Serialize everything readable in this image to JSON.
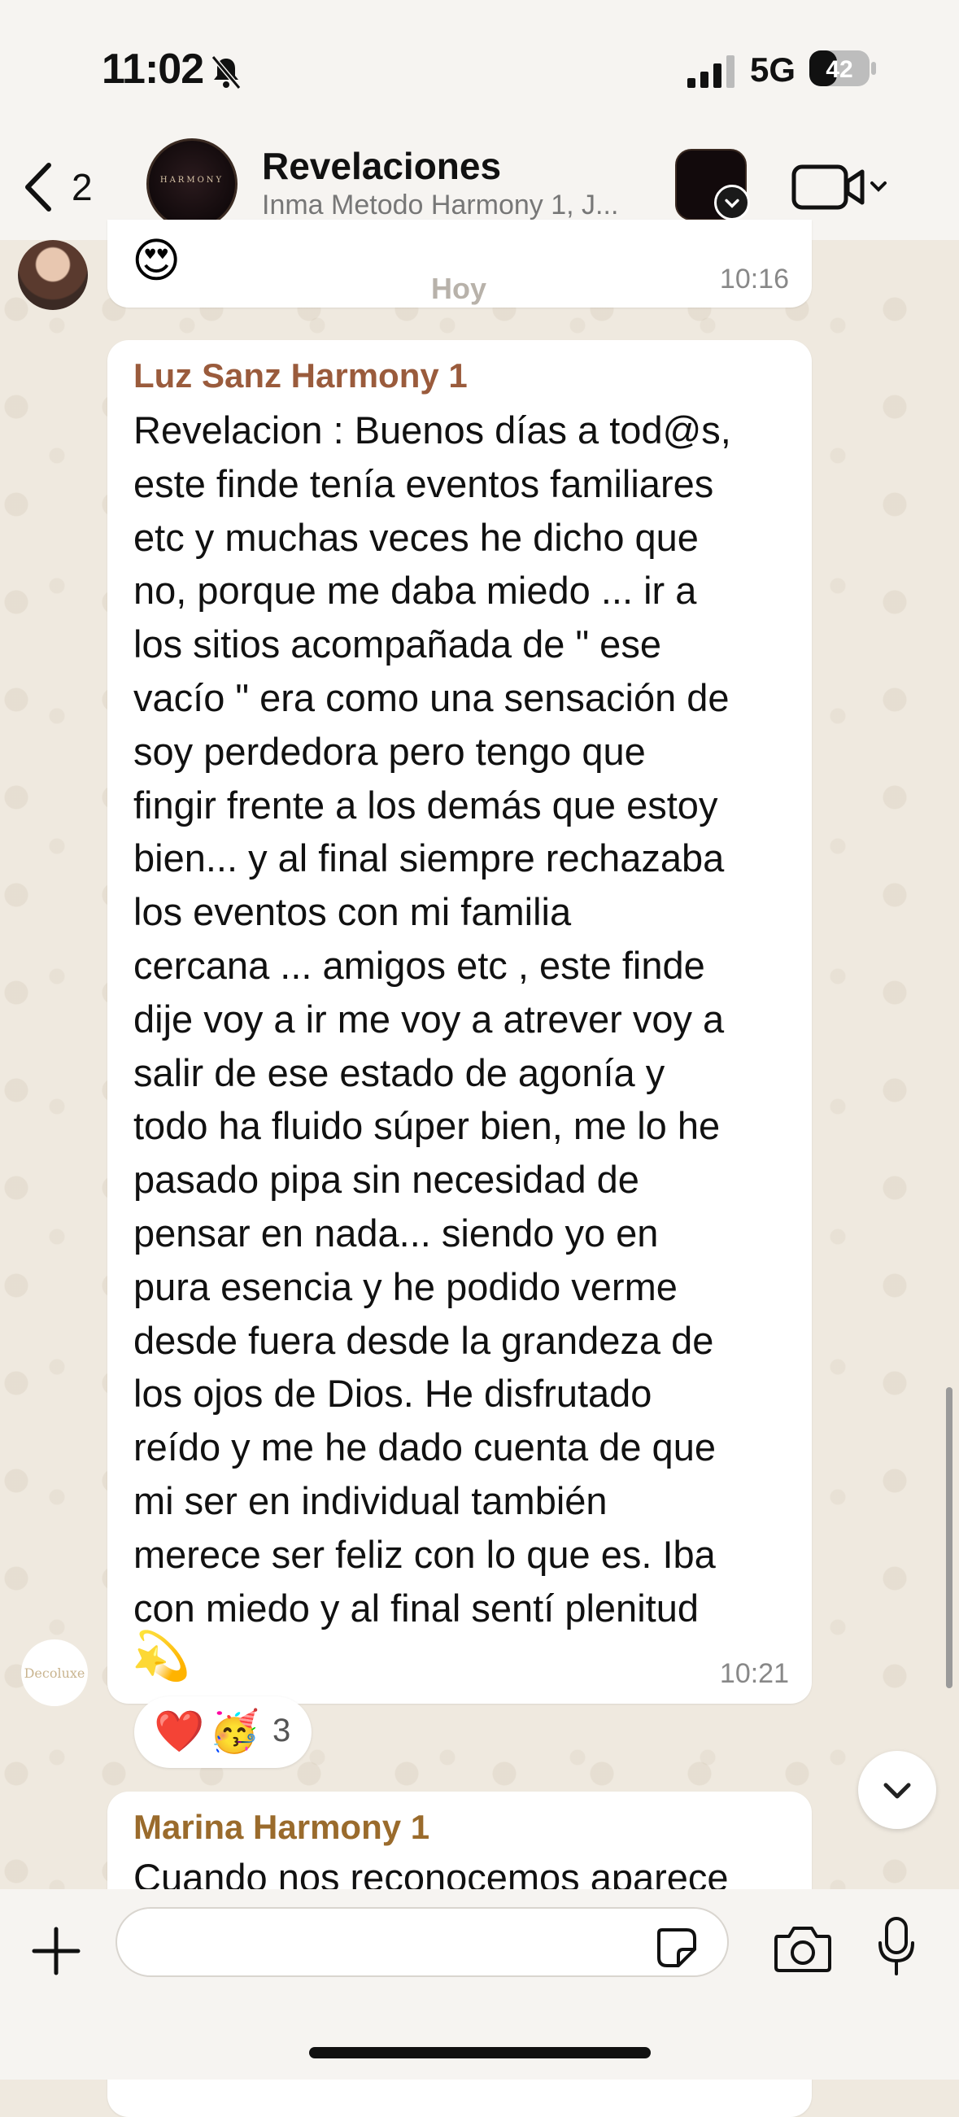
{
  "status_bar": {
    "time": "11:02",
    "network": "5G",
    "battery": "42"
  },
  "header": {
    "back_count": "2",
    "group_avatar_text": "HARMONY",
    "title": "Revelaciones",
    "subtitle": "Inma Metodo Harmony 1, J..."
  },
  "messages": {
    "top_emoji": "😍",
    "top_time": "10:16",
    "day_label": "Hoy",
    "main": {
      "sender": "Luz Sanz Harmony 1",
      "text": "Revelacion : Buenos días a tod@s,\neste finde tenía eventos familiares\netc y muchas veces he dicho que\nno, porque me daba miedo ... ir a\nlos sitios acompañada de \" ese\nvacío \" era como una sensación de\nsoy perdedora pero tengo que\nfingir frente a los demás que estoy\nbien... y al final siempre rechazaba\nlos eventos con mi familia\ncercana ... amigos etc , este finde\ndije voy a ir me voy a atrever voy a\nsalir de ese estado de agonía y\ntodo ha fluido súper bien, me lo he\npasado pipa sin necesidad de\npensar en nada... siendo yo en\npura esencia y he podido verme\ndesde fuera desde la grandeza de\nlos ojos de Dios. He disfrutado\nreído y me he dado cuenta de que\nmi ser en individual también\nmerece ser feliz con lo que es. Iba\ncon miedo y al final sentí plenitud",
      "emoji": "💫",
      "time": "10:21",
      "reactions": {
        "heart": "❤️",
        "party": "🥳",
        "count": "3"
      }
    },
    "next": {
      "sender": "Marina Harmony 1",
      "text": "Cuando nos reconocemos aparece"
    },
    "company_logo_text": "Decoluxe"
  },
  "composer": {
    "placeholder": ""
  }
}
